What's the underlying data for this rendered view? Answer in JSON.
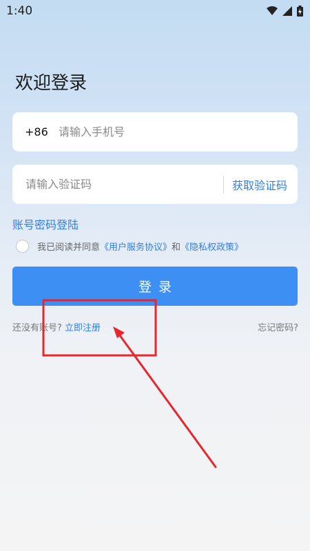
{
  "status_bar": {
    "time": "1:40",
    "icons": [
      "wifi-icon",
      "cellular-signal-icon",
      "battery-charging-icon"
    ]
  },
  "login": {
    "title": "欢迎登录",
    "phone": {
      "prefix": "+86",
      "placeholder": "请输入手机号",
      "value": ""
    },
    "code": {
      "placeholder": "请输入验证码",
      "value": "",
      "get_code_label": "获取验证码"
    },
    "password_login_label": "账号密码登陆",
    "agreement": {
      "checked": false,
      "prefix": "我已阅读并同意",
      "terms_label": "《用户服务协议》",
      "conjunction": "和",
      "privacy_label": "《隐私权政策》"
    },
    "login_button_label": "登录",
    "register": {
      "prompt": "还没有账号?",
      "link_label": "立即注册"
    },
    "forgot_label": "忘记密码?"
  },
  "colors": {
    "accent": "#2f7fe8",
    "login_button": "#3d8ff3",
    "annotation": "#e8262b"
  }
}
